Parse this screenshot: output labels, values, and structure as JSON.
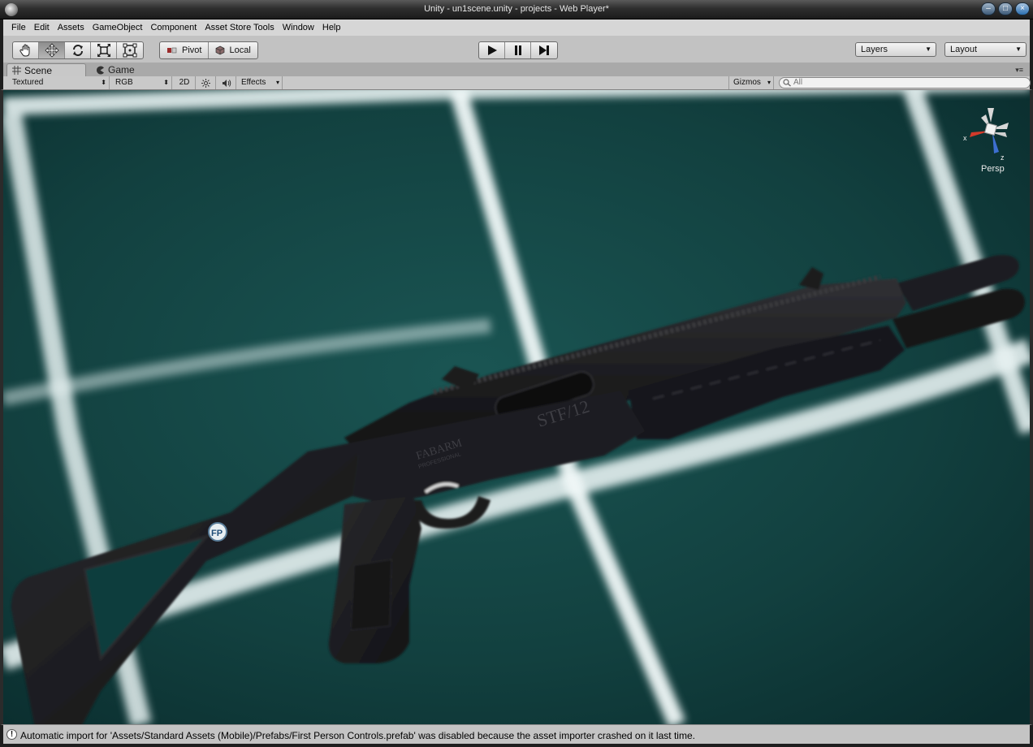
{
  "window": {
    "title": "Unity - un1scene.unity - projects - Web Player*",
    "controls": [
      "minimize-icon",
      "maximize-icon",
      "close-icon"
    ]
  },
  "menu": {
    "items": [
      "File",
      "Edit",
      "Assets",
      "GameObject",
      "Component",
      "Asset Store Tools",
      "Window",
      "Help"
    ]
  },
  "toolbar": {
    "tools": [
      "hand-icon",
      "move-icon",
      "rotate-icon",
      "scale-icon",
      "rect-icon"
    ],
    "active_tool": "move-icon",
    "pivot_label": "Pivot",
    "local_label": "Local",
    "playback": [
      "play-icon",
      "pause-icon",
      "step-icon"
    ],
    "layers_label": "Layers",
    "layout_label": "Layout"
  },
  "tabs": {
    "scene_label": "Scene",
    "game_label": "Game",
    "active": "Scene"
  },
  "scene_toolbar": {
    "draw_mode": "Textured",
    "render_mode": "RGB",
    "mode_2d": "2D",
    "effects_label": "Effects",
    "gizmos_label": "Gizmos",
    "search_placeholder": "All"
  },
  "viewport": {
    "gizmo_x": "x",
    "gizmo_z": "z",
    "projection_label": "Persp",
    "model_text_1": "STF/12",
    "model_text_2": "FABARM",
    "model_text_3": "PROFESSIONAL",
    "model_logo": "FP",
    "colors": {
      "floor": "#10403f",
      "grid": "#e8f2f2",
      "gun": "#1c1c1e"
    }
  },
  "status": {
    "message": "Automatic import for 'Assets/Standard Assets (Mobile)/Prefabs/First Person Controls.prefab' was disabled because the asset importer crashed on it last time."
  }
}
